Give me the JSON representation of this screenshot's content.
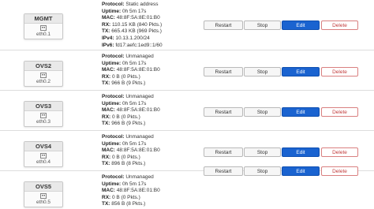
{
  "buttons": {
    "restart": "Restart",
    "stop": "Stop",
    "edit": "Edit",
    "delete": "Delete"
  },
  "colors": {
    "edit_button": "#1a63d0",
    "delete_text": "#c23b3b",
    "divider": "#dddddd"
  },
  "interfaces": [
    {
      "name": "MGMT",
      "icon": "network-port-icon",
      "device": "eth0.1",
      "details": [
        {
          "label": "Protocol:",
          "value": "Static address"
        },
        {
          "label": "Uptime:",
          "value": "0h 5m 17s"
        },
        {
          "label": "MAC:",
          "value": "48:8F:5A:8E:01:B0"
        },
        {
          "label": "RX:",
          "value": "110.15 KB (840 Pkts.)"
        },
        {
          "label": "TX:",
          "value": "665.43 KB (969 Pkts.)"
        },
        {
          "label": "IPv4:",
          "value": "10.13.1.200/24"
        },
        {
          "label": "IPv6:",
          "value": "fd17:aefc:1ed9::1/60"
        }
      ]
    },
    {
      "name": "OVS2",
      "icon": "network-port-icon",
      "device": "eth0.2",
      "details": [
        {
          "label": "Protocol:",
          "value": "Unmanaged"
        },
        {
          "label": "Uptime:",
          "value": "0h 5m 17s"
        },
        {
          "label": "MAC:",
          "value": "48:8F:5A:8E:01:B0"
        },
        {
          "label": "RX:",
          "value": "0 B (0 Pkts.)"
        },
        {
          "label": "TX:",
          "value": "966 B (9 Pkts.)"
        }
      ]
    },
    {
      "name": "OVS3",
      "icon": "network-port-icon",
      "device": "eth0.3",
      "details": [
        {
          "label": "Protocol:",
          "value": "Unmanaged"
        },
        {
          "label": "Uptime:",
          "value": "0h 5m 17s"
        },
        {
          "label": "MAC:",
          "value": "48:8F:5A:8E:01:B0"
        },
        {
          "label": "RX:",
          "value": "0 B (0 Pkts.)"
        },
        {
          "label": "TX:",
          "value": "966 B (9 Pkts.)"
        }
      ]
    },
    {
      "name": "OVS4",
      "icon": "network-port-icon",
      "device": "eth0.4",
      "details": [
        {
          "label": "Protocol:",
          "value": "Unmanaged"
        },
        {
          "label": "Uptime:",
          "value": "0h 5m 17s"
        },
        {
          "label": "MAC:",
          "value": "48:8F:5A:8E:01:B0"
        },
        {
          "label": "RX:",
          "value": "0 B (0 Pkts.)"
        },
        {
          "label": "TX:",
          "value": "896 B (8 Pkts.)"
        }
      ]
    },
    {
      "name": "OVS5",
      "icon": "network-port-icon",
      "device": "eth0.5",
      "details": [
        {
          "label": "Protocol:",
          "value": "Unmanaged"
        },
        {
          "label": "Uptime:",
          "value": "0h 5m 17s"
        },
        {
          "label": "MAC:",
          "value": "48:8F:5A:8E:01:B0"
        },
        {
          "label": "RX:",
          "value": "0 B (0 Pkts.)"
        },
        {
          "label": "TX:",
          "value": "856 B (8 Pkts.)"
        }
      ]
    }
  ]
}
